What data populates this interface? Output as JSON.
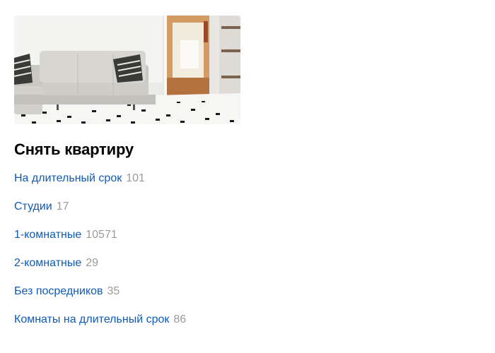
{
  "section": {
    "image_alt": "living-room photo",
    "title": "Снять квартиру",
    "links": [
      {
        "label": "На длительный срок",
        "count": "101"
      },
      {
        "label": "Студии",
        "count": "17"
      },
      {
        "label": "1-комнатные",
        "count": "10571"
      },
      {
        "label": "2-комнатные",
        "count": "29"
      },
      {
        "label": "Без посредников",
        "count": "35"
      },
      {
        "label": "Комнаты на длительный срок",
        "count": "86"
      }
    ]
  },
  "colors": {
    "link": "#0f5ab5",
    "count": "#9a9a9a",
    "title": "#000000"
  }
}
